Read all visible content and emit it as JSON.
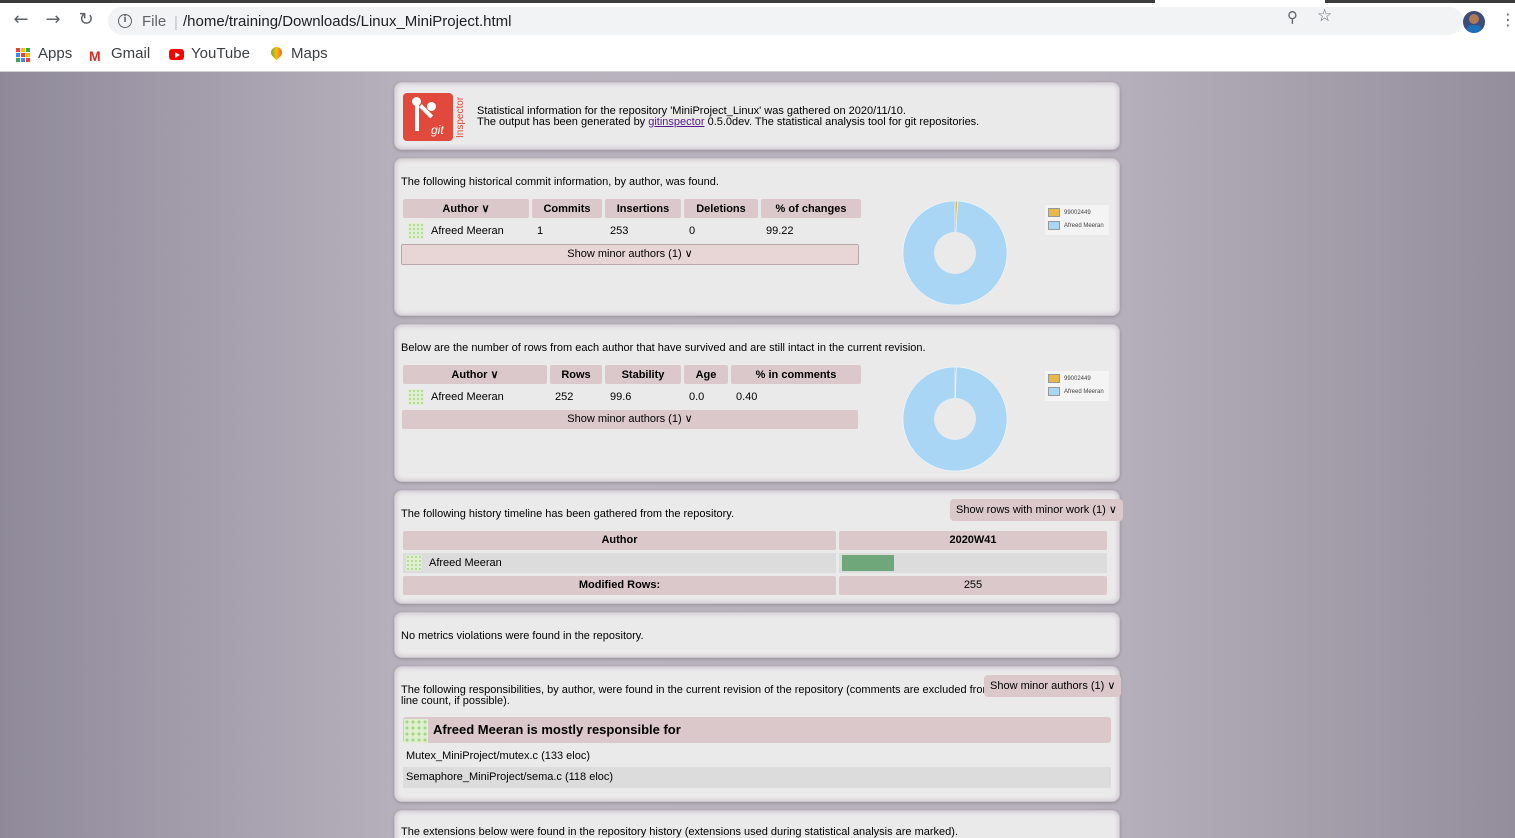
{
  "browser": {
    "file_label": "File",
    "url": "/home/training/Downloads/Linux_MiniProject.html",
    "bookmarks": [
      {
        "label": "Apps"
      },
      {
        "label": "Gmail"
      },
      {
        "label": "YouTube"
      },
      {
        "label": "Maps"
      }
    ]
  },
  "header": {
    "logo_text": "git",
    "logo_side_text": "Inspector",
    "line1": "Statistical information for the repository 'MiniProject_Linux' was gathered on 2020/11/10.",
    "line2_pre": "The output has been generated by ",
    "line2_link": "gitinspector",
    "line2_post": " 0.5.0dev. The statistical analysis tool for git repositories."
  },
  "commits": {
    "intro": "The following historical commit information, by author, was found.",
    "columns": [
      "Author ∨",
      "Commits",
      "Insertions",
      "Deletions",
      "% of changes"
    ],
    "rows": [
      {
        "author": "Afreed Meeran",
        "commits": "1",
        "insertions": "253",
        "deletions": "0",
        "percent": "99.22"
      }
    ],
    "minor_label": "Show minor authors (1) ∨",
    "legend": [
      "99002449",
      "Afreed Meeran"
    ],
    "pie": [
      0.78,
      99.22
    ]
  },
  "blame": {
    "intro": "Below are the number of rows from each author that have survived and are still intact in the current revision.",
    "columns": [
      "Author ∨",
      "Rows",
      "Stability",
      "Age",
      "% in comments"
    ],
    "rows": [
      {
        "author": "Afreed Meeran",
        "rows": "252",
        "stability": "99.6",
        "age": "0.0",
        "comments": "0.40"
      }
    ],
    "minor_label": "Show minor authors (1) ∨",
    "legend": [
      "99002449",
      "Afreed Meeran"
    ],
    "pie": [
      0.4,
      99.6
    ]
  },
  "timeline": {
    "intro": "The following history timeline has been gathered from the repository.",
    "button": "Show rows with minor work (1) ∨",
    "col_author": "Author",
    "col_period": "2020W41",
    "author": "Afreed Meeran",
    "modified_label": "Modified Rows:",
    "modified_value": "255",
    "bar_fill_fraction": 0.2
  },
  "metrics": {
    "text": "No metrics violations were found in the repository."
  },
  "responsibilities": {
    "intro_line1": "The following responsibilities, by author, were found in the current revision of the repository (comments are excluded from the",
    "intro_line2": "line count, if possible).",
    "button": "Show minor authors (1) ∨",
    "heading": "Afreed Meeran is mostly responsible for",
    "files": [
      "Mutex_MiniProject/mutex.c (133 eloc)",
      "Semaphore_MiniProject/sema.c (118 eloc)"
    ]
  },
  "extensions": {
    "intro": "The extensions below were found in the repository history (extensions used during statistical analysis are marked)."
  },
  "colors": {
    "minor_slice": "#e8b84a",
    "main_slice": "#a9d6f5"
  }
}
